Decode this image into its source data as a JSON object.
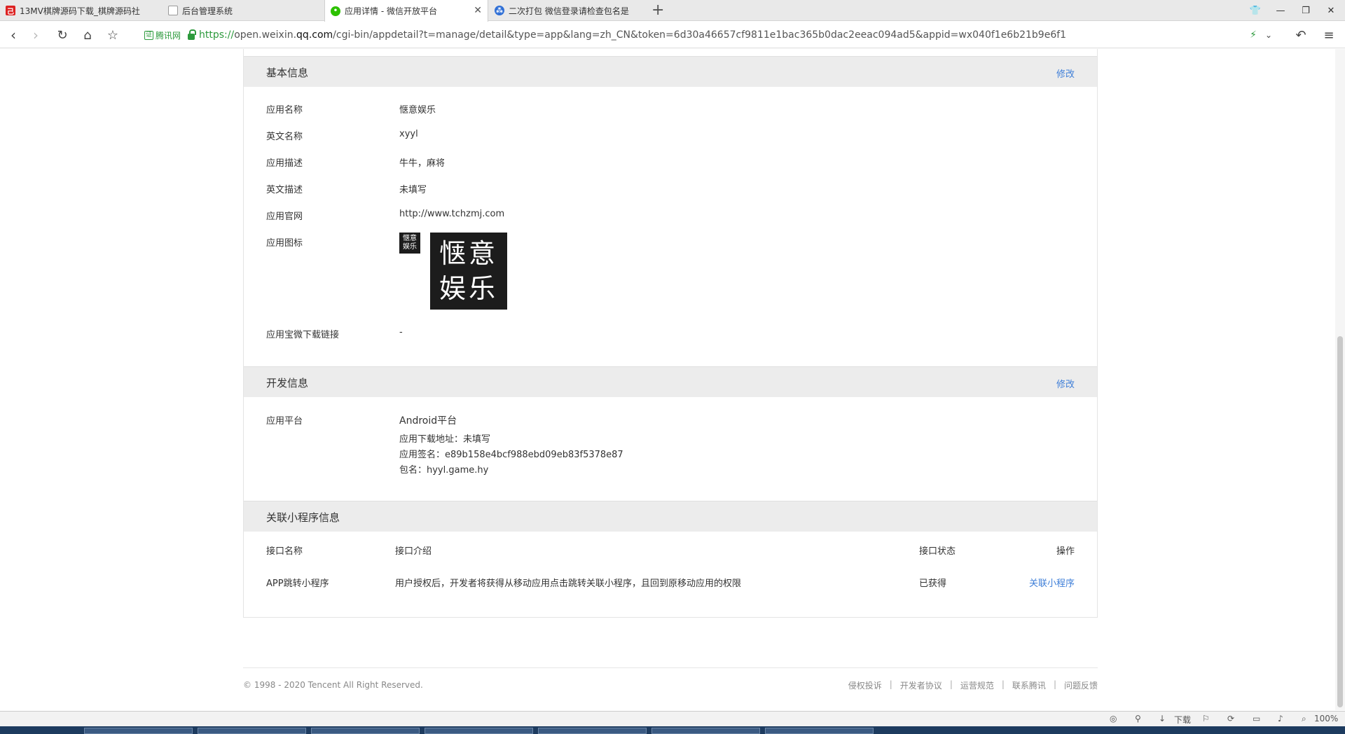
{
  "tabs": [
    {
      "favicon": "13mv-icon",
      "title": "13MV棋牌源码下载_棋牌源码社"
    },
    {
      "favicon": "document-icon",
      "title": "后台管理系统"
    },
    {
      "favicon": "wechat-icon",
      "title": "应用详情 - 微信开放平台"
    },
    {
      "favicon": "baidu-paw-icon",
      "title": "二次打包 微信登录请检查包名是"
    }
  ],
  "browser": {
    "badge": "腾讯网",
    "url_proto": "https://",
    "url_host_pre": "open.weixin.",
    "url_host_main": "qq.com",
    "url_path": "/cgi-bin/appdetail?t=manage/detail&type=app&lang=zh_CN&token=6d30a46657cf9811e1bac365b0dac2eeac094ad5&appid=wx040f1e6b21b9e6f1"
  },
  "basic": {
    "title": "基本信息",
    "edit": "修改",
    "rows": [
      {
        "label": "应用名称",
        "value": "惬意娱乐"
      },
      {
        "label": "英文名称",
        "value": "xyyl"
      },
      {
        "label": "应用描述",
        "value": "牛牛，麻将"
      },
      {
        "label": "英文描述",
        "value": "未填写"
      },
      {
        "label": "应用官网",
        "value": "http://www.tchzmj.com"
      }
    ],
    "icon_label": "应用图标",
    "icon_text_top": "惬意",
    "icon_text_bottom": "娱乐",
    "yyb_label": "应用宝微下载链接",
    "yyb_value": "-"
  },
  "dev": {
    "title": "开发信息",
    "edit": "修改",
    "platform_label": "应用平台",
    "platform": "Android平台",
    "download": "应用下载地址：未填写",
    "signature": "应用签名：e89b158e4bcf988ebd09eb83f5378e87",
    "package": "包名：hyyl.game.hy"
  },
  "mini": {
    "title": "关联小程序信息",
    "headers": {
      "name": "接口名称",
      "desc": "接口介绍",
      "status": "接口状态",
      "op": "操作"
    },
    "row": {
      "name": "APP跳转小程序",
      "desc": "用户授权后，开发者将获得从移动应用点击跳转关联小程序，且回到原移动应用的权限",
      "status": "已获得",
      "op": "关联小程序"
    }
  },
  "footer": {
    "copyright": "© 1998 - 2020 Tencent All Right Reserved.",
    "links": [
      "侵权投诉",
      "开发者协议",
      "运营规范",
      "联系腾讯",
      "问题反馈"
    ]
  },
  "status": {
    "download": "下载",
    "zoom": "100%"
  },
  "colors": {
    "link": "#3f7fd8",
    "secure": "#2c9a3c"
  }
}
